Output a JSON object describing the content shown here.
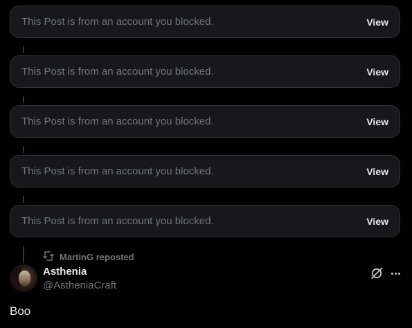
{
  "blocked_posts": [
    {
      "message": "This Post is from an account you blocked.",
      "action": "View"
    },
    {
      "message": "This Post is from an account you blocked.",
      "action": "View"
    },
    {
      "message": "This Post is from an account you blocked.",
      "action": "View"
    },
    {
      "message": "This Post is from an account you blocked.",
      "action": "View"
    },
    {
      "message": "This Post is from an account you blocked.",
      "action": "View"
    }
  ],
  "repost": {
    "label": "MartinG reposted",
    "icon": "repost-icon"
  },
  "post": {
    "author_name": "Asthenia",
    "author_handle": "@AstheniaCraft",
    "text": "Boo",
    "icons": [
      "grok-icon",
      "more-icon"
    ]
  },
  "colors": {
    "background": "#000000",
    "card_background": "#16181c",
    "card_border": "#2f3336",
    "muted_text": "#71767b",
    "primary_text": "#e7e9ea"
  }
}
